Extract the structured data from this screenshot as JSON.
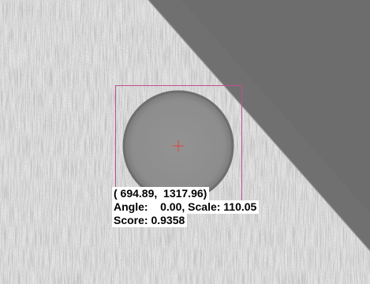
{
  "match_result": {
    "position_text": "( 694.89,  1317.96)",
    "angle_label": "Angle:",
    "angle_value": "0.00",
    "scale_label": "Scale:",
    "scale_value": "110.05",
    "score_label": "Score:",
    "score_value": "0.9358"
  },
  "colors": {
    "bounding_box": "#c0508f",
    "center_marker": "#e04040",
    "circle_fill": "#8e8e8e",
    "circle_edge": "#6d6d6d",
    "dark_region": "#6f6f6f",
    "textured_region": "#e6e6e6",
    "label_background": "#ffffff",
    "label_text": "#000000"
  }
}
